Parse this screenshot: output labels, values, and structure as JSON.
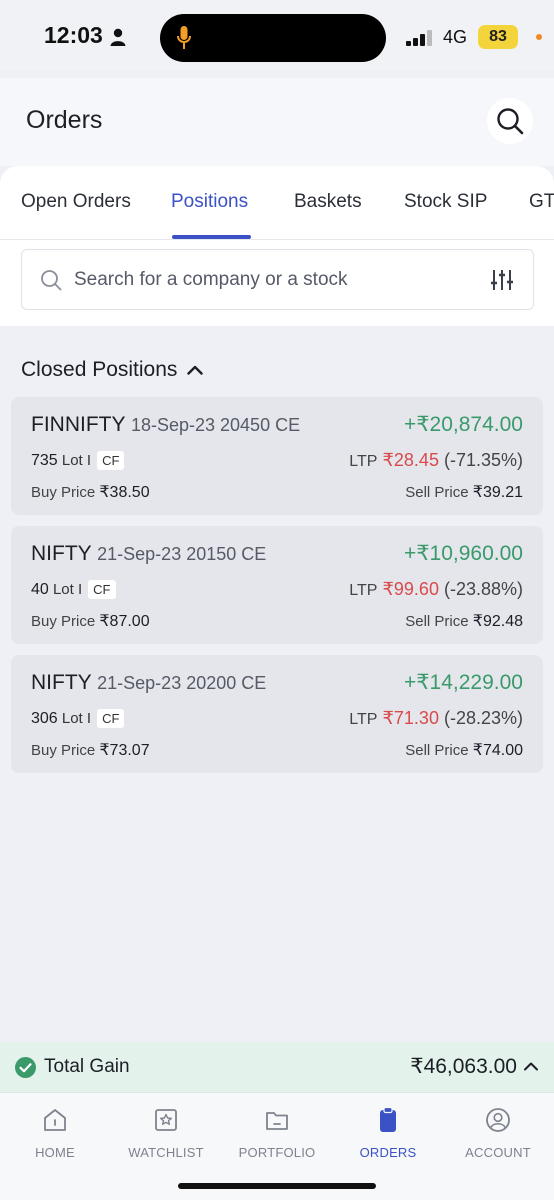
{
  "status_bar": {
    "time": "12:03",
    "network": "4G",
    "battery": "83"
  },
  "header": {
    "title": "Orders"
  },
  "tabs": [
    {
      "label": "Open Orders"
    },
    {
      "label": "Positions"
    },
    {
      "label": "Baskets"
    },
    {
      "label": "Stock SIP"
    },
    {
      "label": "GT"
    }
  ],
  "search": {
    "placeholder": "Search for a company or a stock"
  },
  "closed_positions": {
    "title": "Closed Positions",
    "items": [
      {
        "symbol": "FINNIFTY",
        "contract": "18-Sep-23 20450 CE",
        "pnl": "+₹20,874.00",
        "qty": "735",
        "lot_label": "Lot I",
        "badge": "CF",
        "ltp_label": "LTP",
        "ltp": "₹28.45",
        "change": "(-71.35%)",
        "buy_label": "Buy Price",
        "buy": "₹38.50",
        "sell_label": "Sell Price",
        "sell": "₹39.21"
      },
      {
        "symbol": "NIFTY",
        "contract": "21-Sep-23 20150 CE",
        "pnl": "+₹10,960.00",
        "qty": "40",
        "lot_label": "Lot I",
        "badge": "CF",
        "ltp_label": "LTP",
        "ltp": "₹99.60",
        "change": "(-23.88%)",
        "buy_label": "Buy Price",
        "buy": "₹87.00",
        "sell_label": "Sell Price",
        "sell": "₹92.48"
      },
      {
        "symbol": "NIFTY",
        "contract": "21-Sep-23 20200 CE",
        "pnl": "+₹14,229.00",
        "qty": "306",
        "lot_label": "Lot I",
        "badge": "CF",
        "ltp_label": "LTP",
        "ltp": "₹71.30",
        "change": "(-28.23%)",
        "buy_label": "Buy Price",
        "buy": "₹73.07",
        "sell_label": "Sell Price",
        "sell": "₹74.00"
      }
    ]
  },
  "total_gain": {
    "label": "Total Gain",
    "value": "₹46,063.00"
  },
  "bottom_nav": [
    {
      "label": "HOME",
      "icon": "home-icon"
    },
    {
      "label": "WATCHLIST",
      "icon": "star-icon"
    },
    {
      "label": "PORTFOLIO",
      "icon": "folder-icon"
    },
    {
      "label": "ORDERS",
      "icon": "clipboard-icon"
    },
    {
      "label": "ACCOUNT",
      "icon": "account-icon"
    }
  ],
  "colors": {
    "accent": "#3a52c6",
    "profit": "#3a9a6a",
    "loss": "#d94b4b",
    "gain_bar": "#e3f2ea"
  }
}
